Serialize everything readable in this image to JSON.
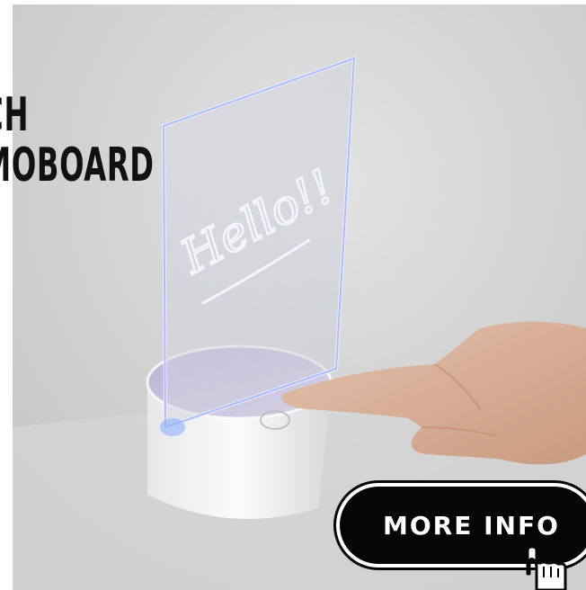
{
  "ad": {
    "headline_line1": "CH",
    "headline_line2": "MOBOARD",
    "board_handwriting": "Hello!!",
    "button_label": "MORE INFO",
    "colors": {
      "button_bg": "#050505",
      "button_text": "#ffffff",
      "headline": "#111111",
      "glow": "#9fb8ff"
    },
    "icons": {
      "cursor": "hand-pointer-icon"
    }
  }
}
